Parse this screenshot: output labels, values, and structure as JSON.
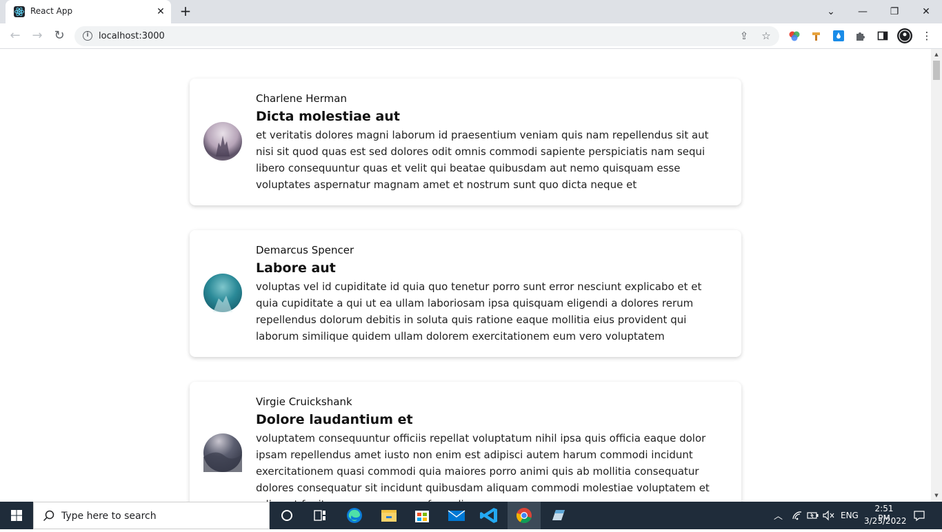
{
  "browser": {
    "tab_title": "React App",
    "url": "localhost:3000"
  },
  "posts": [
    {
      "author": "Charlene Herman",
      "title": "Dicta molestiae aut",
      "body": "et veritatis dolores magni laborum id praesentium veniam quis nam repellendus sit aut nisi sit quod quas est sed dolores odit omnis commodi sapiente perspiciatis nam sequi libero consequuntur quas et velit qui beatae quibusdam aut nemo quisquam esse voluptates aspernatur magnam amet et nostrum sunt quo dicta neque et"
    },
    {
      "author": "Demarcus Spencer",
      "title": "Labore aut",
      "body": "voluptas vel id cupiditate id quia quo tenetur porro sunt error nesciunt explicabo et et quia cupiditate a qui ut ea ullam laboriosam ipsa quisquam eligendi a dolores rerum repellendus dolorum debitis in soluta quis ratione eaque mollitia eius provident qui laborum similique quidem ullam dolorem exercitationem eum vero voluptatem"
    },
    {
      "author": "Virgie Cruickshank",
      "title": "Dolore laudantium et",
      "body": "voluptatem consequuntur officiis repellat voluptatum nihil ipsa quis officia eaque dolor ipsam repellendus amet iusto non enim est adipisci autem harum commodi incidunt exercitationem quasi commodi quia maiores porro animi quis ab mollitia consequatur dolores consequatur sit incidunt quibusdam aliquam commodi molestiae voluptatem et odio aut fugit nemo magnam perferendis"
    }
  ],
  "taskbar": {
    "search_placeholder": "Type here to search",
    "language": "ENG",
    "time": "2:51 PM",
    "date": "3/23/2022"
  },
  "icons": {
    "tab": [
      "react-favicon",
      "close-icon",
      "plus-icon"
    ],
    "window": [
      "chevron-down-icon",
      "minimize-icon",
      "restore-icon",
      "close-icon"
    ],
    "toolbar": [
      "back-arrow-icon",
      "forward-arrow-icon",
      "reload-icon",
      "info-icon",
      "share-icon",
      "star-icon",
      "extension-color-icon",
      "extension-hammer-icon",
      "extension-drop-icon",
      "puzzle-icon",
      "sidepanel-icon",
      "profile-avatar",
      "kebab-menu-icon"
    ],
    "taskbar": [
      "windows-logo-icon",
      "search-icon",
      "cortana-icon",
      "task-view-icon",
      "edge-icon",
      "file-explorer-icon",
      "store-icon",
      "mail-icon",
      "vscode-icon",
      "chrome-icon",
      "notepad-icon",
      "tray-chevron-up-icon",
      "wifi-icon",
      "battery-icon",
      "volume-muted-icon",
      "notifications-icon"
    ]
  },
  "colors": {
    "tabstrip": "#dee1e6",
    "taskbar": "#1f2c3a",
    "react": "#61dafb"
  }
}
